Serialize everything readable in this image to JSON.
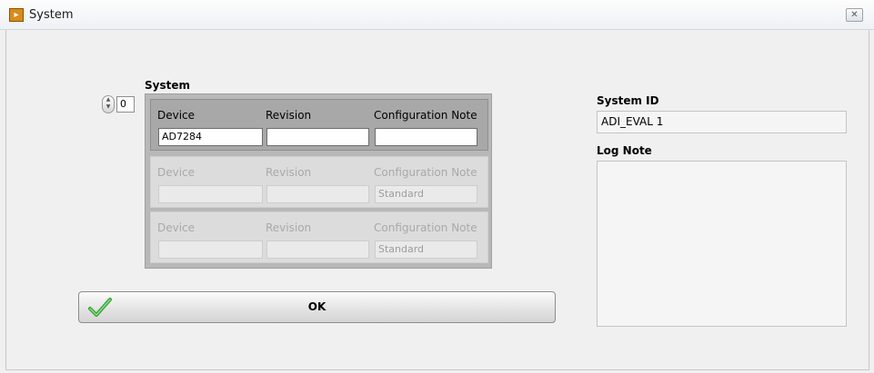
{
  "window": {
    "title": "System",
    "icon": "labview-app-icon",
    "close_icon": "close-icon"
  },
  "system_array": {
    "label": "System",
    "index_value": "0",
    "elements": [
      {
        "device_label": "Device",
        "revision_label": "Revision",
        "config_label": "Configuration Note",
        "device_value": "AD7284",
        "revision_value": "",
        "config_value": ""
      },
      {
        "device_label": "Device",
        "revision_label": "Revision",
        "config_label": "Configuration Note",
        "device_value": "",
        "revision_value": "",
        "config_value": "Standard"
      },
      {
        "device_label": "Device",
        "revision_label": "Revision",
        "config_label": "Configuration Note",
        "device_value": "",
        "revision_value": "",
        "config_value": "Standard"
      }
    ]
  },
  "ok_button": {
    "label": "OK",
    "icon": "checkmark-icon"
  },
  "system_id": {
    "label": "System ID",
    "value": "ADI_EVAL 1"
  },
  "log_note": {
    "label": "Log Note",
    "value": ""
  },
  "colors": {
    "check_green": "#3aa53a",
    "titlebar_icon": "#d98c1a"
  }
}
